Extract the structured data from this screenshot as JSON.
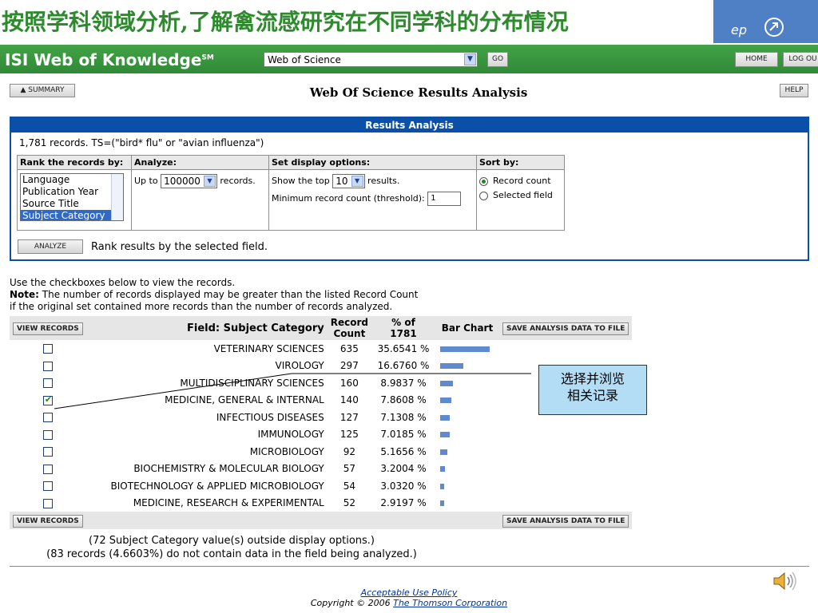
{
  "slide": {
    "title": "按照学科领域分析,了解禽流感研究在不同学科的分布情况",
    "step_text": "ep"
  },
  "header": {
    "logo": "ISI Web of Knowledge",
    "logo_sup": "SM",
    "database": "Web of Science",
    "go_label": "GO",
    "home_label": "HOME",
    "logout_label": "LOG OU"
  },
  "toolbar": {
    "summary_label": "▲ SUMMARY",
    "help_label": "HELP",
    "page_title": "Web Of Science Results Analysis"
  },
  "analysis": {
    "panel_title": "Results Analysis",
    "records_text": "1,781 records. TS=(\"bird* flu\" or \"avian influenza\")",
    "rank_header": "Rank the records by:",
    "analyze_header": "Analyze:",
    "display_header": "Set display options:",
    "sort_header": "Sort by:",
    "rank_options": [
      "Language",
      "Publication Year",
      "Source Title",
      "Subject Category"
    ],
    "selected_rank": "Subject Category",
    "upto_prefix": "Up to",
    "upto_value": "100000",
    "upto_suffix": "records.",
    "show_prefix": "Show the top",
    "show_value": "10",
    "show_suffix": "results.",
    "threshold_label": "Minimum record count (threshold):",
    "threshold_value": "1",
    "sort_options": [
      "Record count",
      "Selected field"
    ],
    "selected_sort": "Record count",
    "analyze_button": "ANALYZE",
    "analyze_caption": "Rank results by the selected field."
  },
  "notes": {
    "line1": "Use the checkboxes below to view the records.",
    "note_label": "Note:",
    "line2": " The number of records displayed may be greater than the listed Record Count",
    "line3": "if the original set contained more records than the number of records analyzed."
  },
  "results": {
    "view_records_label": "VIEW RECORDS",
    "save_label": "SAVE ANALYSIS DATA TO FILE",
    "col_field": "Field: Subject Category",
    "col_count_1": "Record",
    "col_count_2": "Count",
    "col_pct_1": "% of",
    "col_pct_2": "1781",
    "col_bar": "Bar Chart",
    "rows": [
      {
        "field": "VETERINARY SCIENCES",
        "count": "635",
        "pct": "35.6541 %",
        "pct_value": 35.6541,
        "checked": false
      },
      {
        "field": "VIROLOGY",
        "count": "297",
        "pct": "16.6760 %",
        "pct_value": 16.676,
        "checked": false
      },
      {
        "field": "MULTIDISCIPLINARY SCIENCES",
        "count": "160",
        "pct": "8.9837 %",
        "pct_value": 8.9837,
        "checked": false
      },
      {
        "field": "MEDICINE, GENERAL & INTERNAL",
        "count": "140",
        "pct": "7.8608 %",
        "pct_value": 7.8608,
        "checked": true
      },
      {
        "field": "INFECTIOUS DISEASES",
        "count": "127",
        "pct": "7.1308 %",
        "pct_value": 7.1308,
        "checked": false
      },
      {
        "field": "IMMUNOLOGY",
        "count": "125",
        "pct": "7.0185 %",
        "pct_value": 7.0185,
        "checked": false
      },
      {
        "field": "MICROBIOLOGY",
        "count": "92",
        "pct": "5.1656 %",
        "pct_value": 5.1656,
        "checked": false
      },
      {
        "field": "BIOCHEMISTRY & MOLECULAR BIOLOGY",
        "count": "57",
        "pct": "3.2004 %",
        "pct_value": 3.2004,
        "checked": false
      },
      {
        "field": "BIOTECHNOLOGY & APPLIED MICROBIOLOGY",
        "count": "54",
        "pct": "3.0320 %",
        "pct_value": 3.032,
        "checked": false
      },
      {
        "field": "MEDICINE, RESEARCH & EXPERIMENTAL",
        "count": "52",
        "pct": "2.9197 %",
        "pct_value": 2.9197,
        "checked": false
      }
    ],
    "footnote1": "(72 Subject Category value(s) outside display options.)",
    "footnote2": "(83 records (4.6603%) do not contain data in the field being analyzed.)"
  },
  "footer": {
    "policy_link": "Acceptable Use Policy",
    "copyright_prefix": "Copyright © 2006 ",
    "company_link": "The Thomson Corporation"
  },
  "annotation": {
    "line1": "选择并浏览",
    "line2": "相关记录"
  },
  "colors": {
    "slide_title": "#2d8a2d",
    "isi_green": "#3a9a3e",
    "panel_blue": "#0a4fa8",
    "bar_blue": "#5f8ad0",
    "callout_bg": "#b3ddf5"
  }
}
